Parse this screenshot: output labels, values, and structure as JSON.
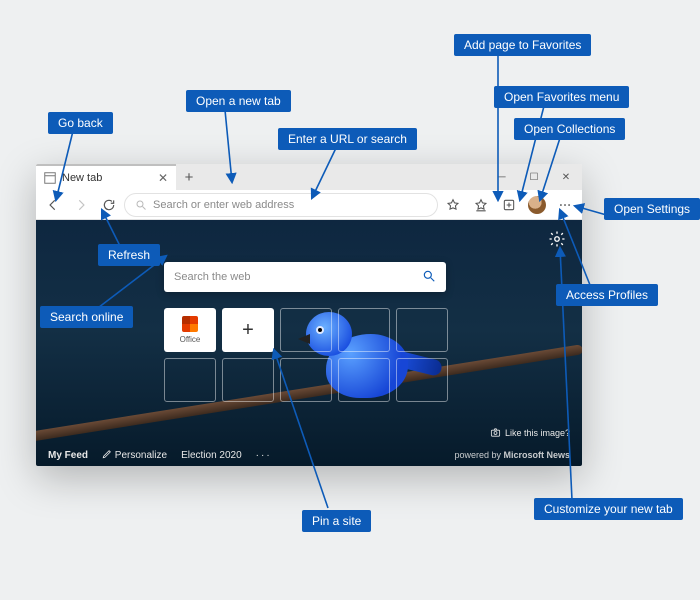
{
  "callouts": {
    "go_back": "Go back",
    "open_new_tab": "Open a new tab",
    "enter_url": "Enter a URL or search",
    "add_favorite": "Add page to Favorites",
    "open_favorites": "Open Favorites menu",
    "open_collections": "Open Collections",
    "open_settings": "Open Settings",
    "access_profiles": "Access Profiles",
    "refresh": "Refresh",
    "search_online": "Search online",
    "pin_site": "Pin a site",
    "customize_tab": "Customize your new tab"
  },
  "tab": {
    "title": "New tab"
  },
  "address_bar": {
    "placeholder": "Search or enter web address"
  },
  "search": {
    "placeholder": "Search the web"
  },
  "tiles": {
    "office": "Office"
  },
  "like_image": "Like this image?",
  "feedbar": {
    "my_feed": "My Feed",
    "personalize": "Personalize",
    "election": "Election 2020",
    "powered_prefix": "powered by ",
    "powered_brand": "Microsoft News"
  }
}
